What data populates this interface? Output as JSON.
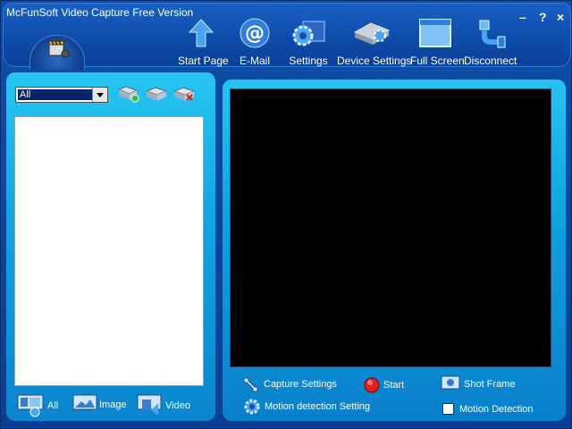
{
  "window": {
    "title": "McFunSoft Video Capture Free Version",
    "controls": {
      "minimize": "–",
      "help": "?",
      "close": "×"
    }
  },
  "toolbar": {
    "items": [
      {
        "id": "start-page",
        "label": "Start Page",
        "icon": "up-arrow-icon"
      },
      {
        "id": "email",
        "label": "E-Mail",
        "icon": "at-sign-icon"
      },
      {
        "id": "settings",
        "label": "Settings",
        "icon": "gear-icon"
      },
      {
        "id": "device-settings",
        "label": "Device Settings",
        "icon": "device-icon"
      },
      {
        "id": "full-screen",
        "label": "Full Screen",
        "icon": "window-icon"
      },
      {
        "id": "disconnect",
        "label": "Disconnect",
        "icon": "plug-icon"
      }
    ]
  },
  "left": {
    "filter_select": {
      "value": "All"
    },
    "filters": [
      {
        "id": "all",
        "label": "All"
      },
      {
        "id": "image",
        "label": "Image"
      },
      {
        "id": "video",
        "label": "Video"
      }
    ]
  },
  "right": {
    "capture_settings": "Capture Settings",
    "start": "Start",
    "shot_frame": "Shot Frame",
    "motion_detection_setting": "Motion detection Setting",
    "motion_detection": {
      "label": "Motion Detection",
      "checked": false
    }
  }
}
